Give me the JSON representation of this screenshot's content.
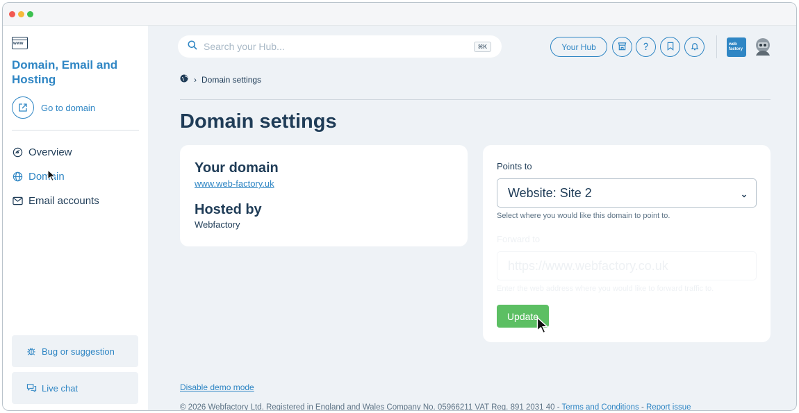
{
  "sidebar": {
    "title": "Domain, Email and Hosting",
    "www_icon_text": "www",
    "go_to_domain": "Go to domain",
    "nav": [
      {
        "label": "Overview",
        "icon": "overview-icon"
      },
      {
        "label": "Domain",
        "icon": "globe-icon"
      },
      {
        "label": "Email accounts",
        "icon": "mail-icon"
      }
    ],
    "bug_button": "Bug or suggestion",
    "chat_button": "Live chat"
  },
  "header": {
    "search_placeholder": "Search your Hub...",
    "search_shortcut": "⌘K",
    "hub_button": "Your Hub",
    "logo_text": "web factory"
  },
  "breadcrumb": {
    "current": "Domain settings"
  },
  "page": {
    "title": "Domain settings"
  },
  "domain_card": {
    "your_domain_label": "Your domain",
    "domain": "www.web-factory.uk",
    "hosted_by_label": "Hosted by",
    "host": "Webfactory"
  },
  "points_card": {
    "points_to_label": "Points to",
    "selected": "Website: Site 2",
    "points_help": "Select where you would like this domain to point to.",
    "forward_label": "Forward to",
    "forward_placeholder": "https://www.webfactory.co.uk",
    "forward_help": "Enter the web address where you would like to forward traffic to.",
    "update_button": "Update"
  },
  "footer": {
    "demo_link": "Disable demo mode",
    "copyright": "© 2026 Webfactory Ltd. Registered in England and Wales Company No. 05966211 VAT Reg. 891 2031 40 - ",
    "terms": "Terms and Conditions",
    "dash": " - ",
    "report": "Report issue"
  },
  "colors": {
    "accent": "#2f86c4",
    "navy": "#1f3c57",
    "success": "#5cbf63",
    "background": "#eef2f6"
  }
}
